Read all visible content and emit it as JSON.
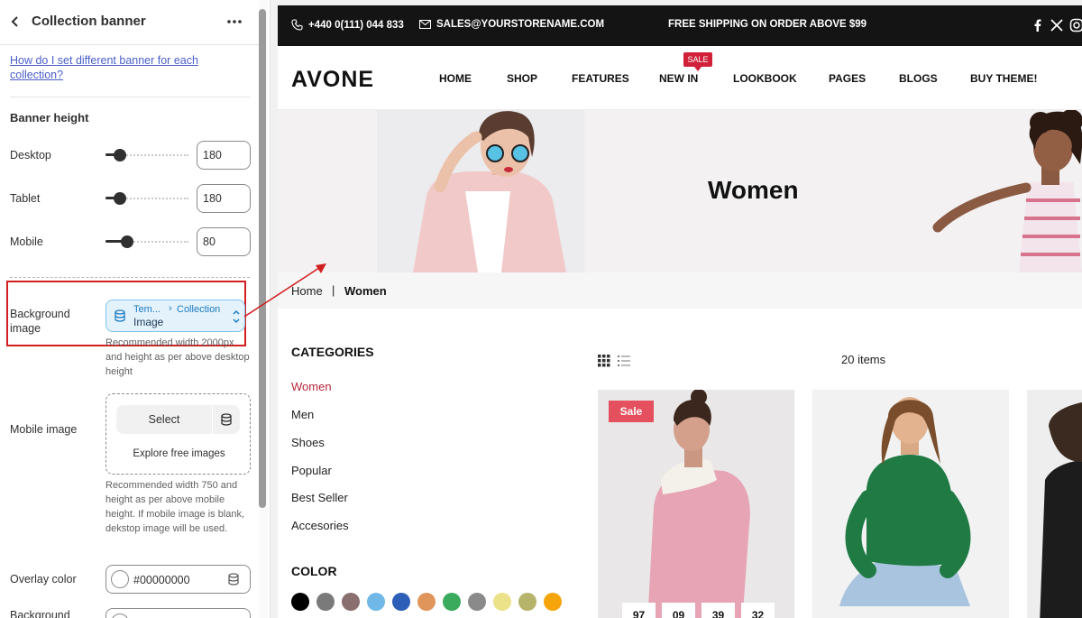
{
  "panel": {
    "title": "Collection banner",
    "help_link": "How do I set different banner for each collection?",
    "banner_height": {
      "title": "Banner height",
      "desktop": {
        "label": "Desktop",
        "value": "180",
        "level": 0.1
      },
      "tablet": {
        "label": "Tablet",
        "value": "180",
        "level": 0.1
      },
      "mobile": {
        "label": "Mobile",
        "value": "80",
        "level": 0.2
      }
    },
    "background_image": {
      "label": "Background image",
      "source_part1": "Tem...",
      "source_part2": "Collection",
      "source_part3": "Image",
      "help": "Recommended width 2000px and height as per above desktop height"
    },
    "mobile_image": {
      "label": "Mobile image",
      "select_label": "Select",
      "explore_label": "Explore free images",
      "help": "Recommended width 750 and height as per above mobile height. If mobile image is blank, dekstop image will be used."
    },
    "overlay_color": {
      "label": "Overlay color",
      "value": "#00000000"
    },
    "background_color": {
      "label": "Background"
    }
  },
  "store": {
    "topbar": {
      "phone": "+440 0(111) 044 833",
      "email": "SALES@YOURSTORENAME.COM",
      "promo": "FREE SHIPPING ON ORDER ABOVE $99"
    },
    "logo": "AVONE",
    "nav": [
      "HOME",
      "SHOP",
      "FEATURES",
      "NEW IN",
      "LOOKBOOK",
      "PAGES",
      "BLOGS",
      "BUY THEME!"
    ],
    "nav_badge": "SALE",
    "hero_title": "Women",
    "breadcrumb": {
      "home": "Home",
      "separator": "|",
      "current": "Women"
    },
    "categories": {
      "title": "CATEGORIES",
      "items": [
        "Women",
        "Men",
        "Shoes",
        "Popular",
        "Best Seller",
        "Accesories"
      ]
    },
    "color_title": "COLOR",
    "color_swatches": [
      "#000000",
      "#7a7a7a",
      "#8a6f6f",
      "#6fb8e8",
      "#2e5fb8",
      "#e0955a",
      "#3aaa5c",
      "#8a8a8a",
      "#ece28a",
      "#b6b46a",
      "#f5a50a"
    ],
    "items_count": "20 items",
    "product_sale_label": "Sale",
    "countdown": [
      "97",
      "09",
      "39",
      "32"
    ]
  },
  "colors": {
    "accent_red": "#d21f1f",
    "link_blue": "#4a5ec9",
    "category_active": "#b8283c"
  }
}
